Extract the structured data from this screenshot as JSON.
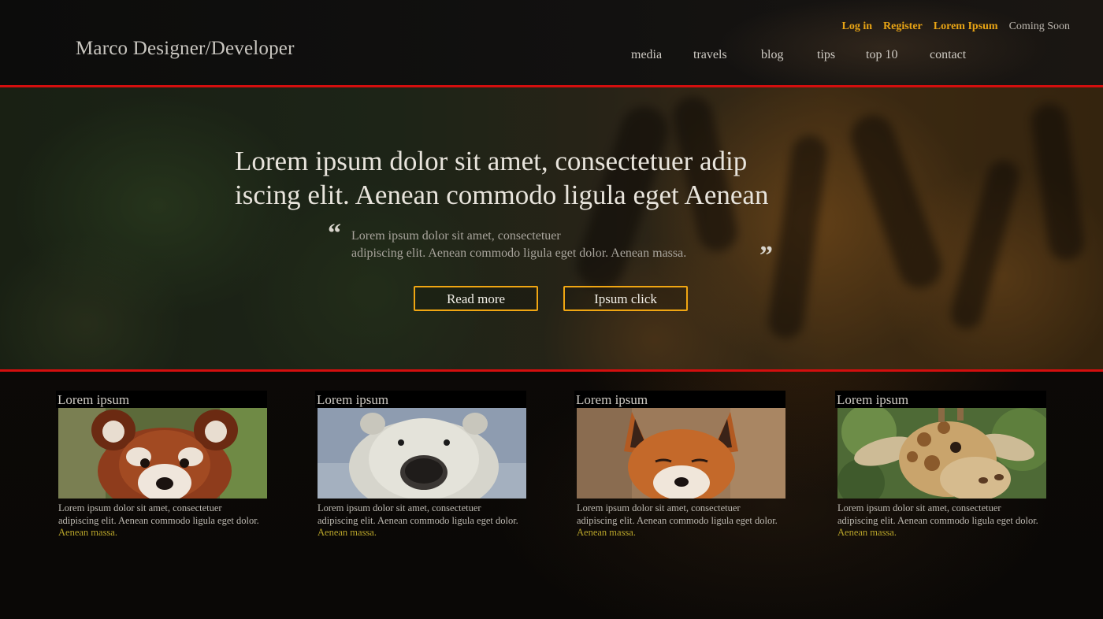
{
  "header": {
    "brand": "Marco Designer/Developer",
    "top_links": [
      {
        "label": "Log in"
      },
      {
        "label": "Register"
      },
      {
        "label": "Lorem Ipsum"
      },
      {
        "label": "Coming Soon"
      }
    ],
    "nav": [
      {
        "label": "media"
      },
      {
        "label": "travels"
      },
      {
        "label": "blog"
      },
      {
        "label": "tips"
      },
      {
        "label": "top 10"
      },
      {
        "label": "contact"
      }
    ]
  },
  "hero": {
    "headline_line1": "Lorem ipsum dolor sit amet, consectetuer adip",
    "headline_line2": "iscing elit. Aenean commodo ligula eget  Aenean",
    "quote_open": "“",
    "quote_close": "”",
    "quote_line1": "Lorem ipsum dolor sit amet, consectetuer",
    "quote_line2": "adipiscing elit. Aenean commodo ligula eget dolor. Aenean massa.",
    "buttons": {
      "read_more": "Read more",
      "ipsum_click": "Ipsum click"
    }
  },
  "cards": [
    {
      "title": "Lorem ipsum",
      "image": "red-panda-photo",
      "text": "Lorem ipsum dolor sit amet, consectetuer adipiscing elit. Aenean commodo ligula eget dolor.",
      "highlight": "Aenean massa."
    },
    {
      "title": "Lorem ipsum",
      "image": "polar-bear-photo",
      "text": "Lorem ipsum dolor sit amet, consectetuer adipiscing elit. Aenean commodo ligula eget dolor.",
      "highlight": "Aenean massa."
    },
    {
      "title": "Lorem ipsum",
      "image": "fox-photo",
      "text": "Lorem ipsum dolor sit amet, consectetuer adipiscing elit. Aenean commodo ligula eget dolor.",
      "highlight": "Aenean massa."
    },
    {
      "title": "Lorem ipsum",
      "image": "giraffe-photo",
      "text": "Lorem ipsum dolor sit amet, consectetuer adipiscing elit. Aenean commodo ligula eget dolor.",
      "highlight": "Aenean massa."
    }
  ],
  "colors": {
    "accent": "#e8a415",
    "divider": "#d40e0e",
    "highlight_text": "#b8a42a"
  }
}
